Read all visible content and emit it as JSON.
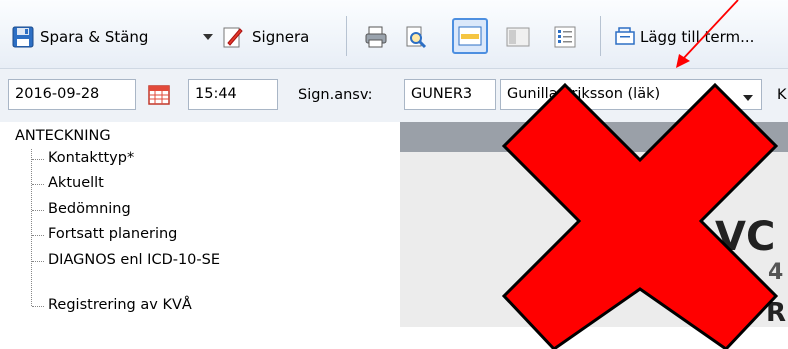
{
  "toolbar": {
    "save_close_label": "Spara & Stäng",
    "sign_label": "Signera",
    "add_term_label": "Lägg till term..."
  },
  "fields": {
    "date": "2016-09-28",
    "time": "15:44",
    "sign_label": "Sign.ansv:",
    "sign_code": "GUNER3",
    "sign_name": "Gunilla Eriksson (läk)",
    "trailing_label": "K"
  },
  "tree": {
    "root": "ANTECKNING",
    "items": [
      "Kontakttyp*",
      "Aktuellt",
      "Bedömning",
      "Fortsatt planering",
      "DIAGNOS enl ICD-10-SE",
      "Registrering av KVÅ"
    ]
  },
  "preview": {
    "text_fragment_1": "VC T",
    "text_fragment_2": "4",
    "text_fragment_3": "R"
  },
  "colors": {
    "overlay_x": "#ff0000",
    "annotation_arrow": "#ff0000",
    "accent_blue": "#2d6fc4"
  }
}
